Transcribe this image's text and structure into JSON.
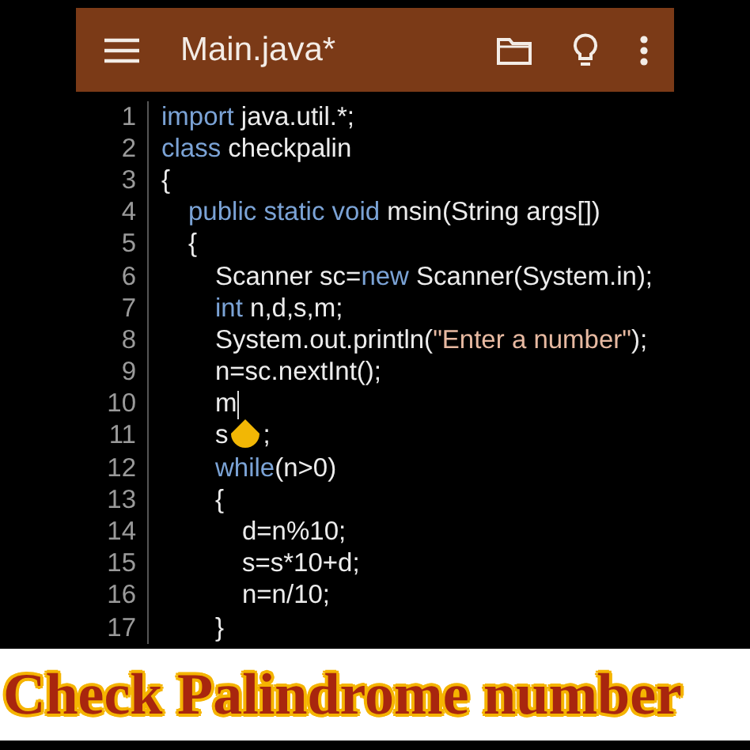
{
  "app_bar": {
    "title": "Main.java*"
  },
  "code": {
    "lines": [
      {
        "number": "1",
        "tokens": [
          {
            "kind": "keyword",
            "text": "import"
          },
          {
            "kind": "plain",
            "text": " java.util.*;"
          }
        ]
      },
      {
        "number": "2",
        "tokens": [
          {
            "kind": "keyword",
            "text": "class"
          },
          {
            "kind": "plain",
            "text": " checkpalin"
          }
        ]
      },
      {
        "number": "3",
        "tokens": [
          {
            "kind": "plain",
            "text": "{"
          }
        ],
        "children": [
          {
            "number": "4",
            "tokens": [
              {
                "kind": "keyword",
                "text": "public static void"
              },
              {
                "kind": "plain",
                "text": " msin(String args[])"
              }
            ]
          },
          {
            "number": "5",
            "tokens": [
              {
                "kind": "plain",
                "text": "{"
              }
            ],
            "children": [
              {
                "number": "6",
                "tokens": [
                  {
                    "kind": "plain",
                    "text": "Scanner sc="
                  },
                  {
                    "kind": "keyword",
                    "text": "new"
                  },
                  {
                    "kind": "plain",
                    "text": " Scanner(System.in);"
                  }
                ]
              },
              {
                "number": "7",
                "tokens": [
                  {
                    "kind": "keyword",
                    "text": "int"
                  },
                  {
                    "kind": "plain",
                    "text": " n,d,s,m;"
                  }
                ]
              },
              {
                "number": "8",
                "tokens": [
                  {
                    "kind": "plain",
                    "text": "System.out.println("
                  },
                  {
                    "kind": "string",
                    "text": "\"Enter a number\""
                  },
                  {
                    "kind": "plain",
                    "text": ");"
                  }
                ]
              },
              {
                "number": "9",
                "tokens": [
                  {
                    "kind": "plain",
                    "text": "n=sc.nextInt();"
                  }
                ]
              },
              {
                "number": "10",
                "tokens": [
                  {
                    "kind": "plain",
                    "text": "m"
                  },
                  {
                    "kind": "cursor"
                  }
                ]
              },
              {
                "number": "11",
                "tokens": [
                  {
                    "kind": "plain",
                    "text": "s"
                  },
                  {
                    "kind": "covered"
                  },
                  {
                    "kind": "plain",
                    "text": ";"
                  }
                ]
              },
              {
                "number": "12",
                "tokens": [
                  {
                    "kind": "keyword",
                    "text": "while"
                  },
                  {
                    "kind": "plain",
                    "text": "(n>0)"
                  }
                ]
              },
              {
                "number": "13",
                "tokens": [
                  {
                    "kind": "plain",
                    "text": "{"
                  }
                ],
                "children": [
                  {
                    "number": "14",
                    "tokens": [
                      {
                        "kind": "plain",
                        "text": "d=n%10;"
                      }
                    ]
                  },
                  {
                    "number": "15",
                    "tokens": [
                      {
                        "kind": "plain",
                        "text": "s=s*10+d;"
                      }
                    ]
                  },
                  {
                    "number": "16",
                    "tokens": [
                      {
                        "kind": "plain",
                        "text": "n=n/10;"
                      }
                    ]
                  }
                ]
              },
              {
                "number": "17",
                "tokens": [
                  {
                    "kind": "plain",
                    "text": "}"
                  }
                ]
              }
            ]
          }
        ]
      }
    ]
  },
  "caption": {
    "text": "Check Palindrome number"
  }
}
